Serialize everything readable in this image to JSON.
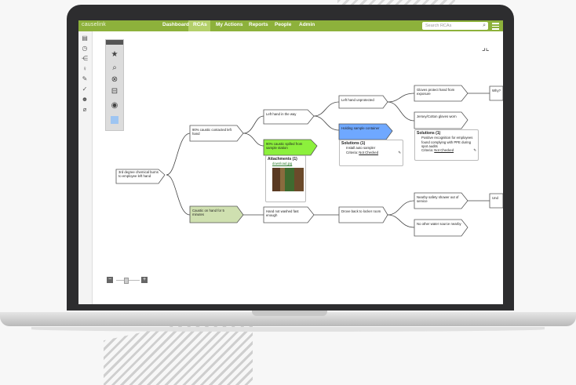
{
  "nav": {
    "logo": "causelink",
    "items": [
      "Dashboard",
      "RCAs",
      "My Actions",
      "Reports",
      "People",
      "Admin"
    ],
    "active": "RCAs",
    "search_placeholder": "Search RCAs"
  },
  "colors": {
    "nav_bg": "#8db13b",
    "nav_active": "#b4d06a",
    "node_green": "#8cf03c",
    "node_blue": "#6fa8ff",
    "node_sage": "#cfe0b0"
  },
  "left_toolbar": {
    "icons": [
      "document-icon",
      "clock-icon",
      "tree-icon",
      "bulb-icon",
      "edit-icon",
      "check-icon",
      "people-icon",
      "paperclip-icon"
    ]
  },
  "tool_panel": {
    "icons": [
      "star-icon",
      "search-icon",
      "cancel-icon",
      "layout-icon",
      "eye-icon",
      "color-swatch"
    ]
  },
  "nodes": {
    "root": "3rd degree chemical burns to employee left hand",
    "n1": "90% caustic contacted left hand",
    "n2": "Caustic on hand for 5 minutes",
    "n3": "Left hand in the way",
    "n4": "90% caustic spilled from sample station",
    "n5": "Hand not washed fast enough",
    "n6": "Left hand unprotected",
    "n7": "Holding sample container",
    "n8": "Drove back to locker room",
    "n9": "Gloves protect hand from exposure",
    "n10": "Jersey/Cotton gloves worn",
    "n11": "Nearby safety shower out of service",
    "n12": "No other water source nearby",
    "n13": "Why?",
    "n14": "Under r"
  },
  "attachments_card": {
    "title": "Attachments (1)",
    "file": "download.jpg"
  },
  "solutions_card_1": {
    "title": "Solutions (1)",
    "item": "Install auto sampler",
    "criteria_label": "Criteria:",
    "criteria_value": "Not Checked"
  },
  "solutions_card_2": {
    "title": "Solutions (1)",
    "item": "Positive recognition for employees found complying with PPE during spot audits",
    "criteria_label": "Criteria:",
    "criteria_value": "Not Checked"
  }
}
